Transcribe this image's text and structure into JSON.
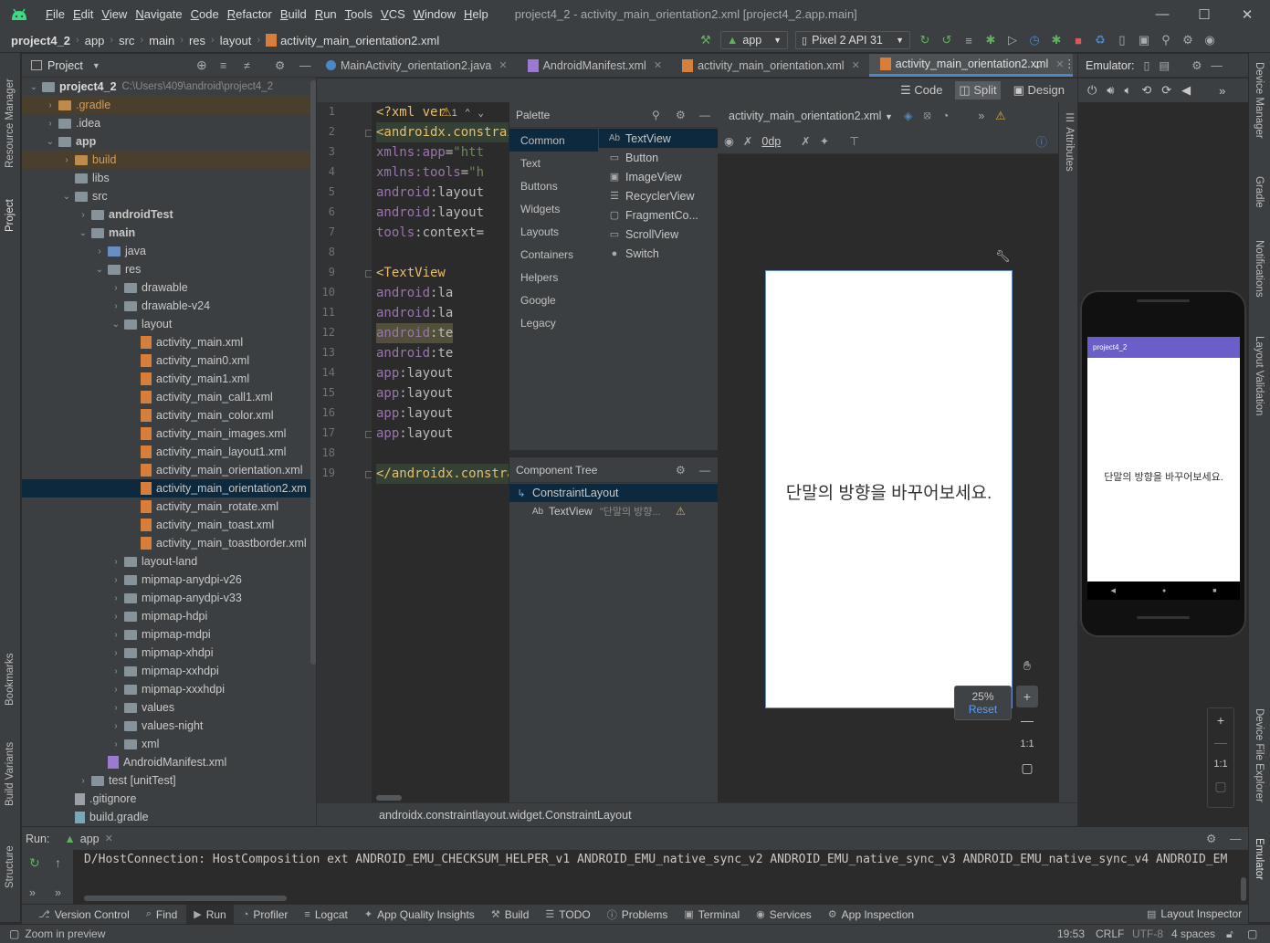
{
  "window": {
    "menu": [
      "File",
      "Edit",
      "View",
      "Navigate",
      "Code",
      "Refactor",
      "Build",
      "Run",
      "Tools",
      "VCS",
      "Window",
      "Help"
    ],
    "title": "project4_2 - activity_main_orientation2.xml [project4_2.app.main]"
  },
  "breadcrumb": [
    "project4_2",
    "app",
    "src",
    "main",
    "res",
    "layout",
    "activity_main_orientation2.xml"
  ],
  "toolbar": {
    "run_config": "app",
    "device": "Pixel 2 API 31"
  },
  "left_strip": {
    "resource_manager": "Resource Manager",
    "project": "Project",
    "bookmarks": "Bookmarks",
    "build_variants": "Build Variants",
    "structure": "Structure"
  },
  "right_strip": {
    "device_manager": "Device Manager",
    "gradle": "Gradle",
    "notifications": "Notifications",
    "layout_validation": "Layout Validation",
    "device_file_explorer": "Device File Explorer",
    "emulator": "Emulator"
  },
  "project_panel": {
    "title": "Project",
    "root": {
      "name": "project4_2",
      "path": "C:\\Users\\409\\android\\project4_2"
    },
    "items": [
      {
        "label": ".gradle",
        "depth": 1,
        "icon": "orange",
        "expanded": false
      },
      {
        "label": ".idea",
        "depth": 1,
        "icon": "gray",
        "expanded": false
      },
      {
        "label": "app",
        "depth": 1,
        "icon": "gray",
        "expanded": true,
        "bold": true
      },
      {
        "label": "build",
        "depth": 2,
        "icon": "orange",
        "expanded": false
      },
      {
        "label": "libs",
        "depth": 2,
        "icon": "gray",
        "leaf": true
      },
      {
        "label": "src",
        "depth": 2,
        "icon": "gray",
        "expanded": true
      },
      {
        "label": "androidTest",
        "depth": 3,
        "icon": "gray",
        "expanded": false,
        "bold": true
      },
      {
        "label": "main",
        "depth": 3,
        "icon": "gray",
        "expanded": true,
        "bold": true
      },
      {
        "label": "java",
        "depth": 4,
        "icon": "blue",
        "expanded": false
      },
      {
        "label": "res",
        "depth": 4,
        "icon": "gray",
        "expanded": true
      },
      {
        "label": "drawable",
        "depth": 5,
        "icon": "gray",
        "expanded": false
      },
      {
        "label": "drawable-v24",
        "depth": 5,
        "icon": "gray",
        "expanded": false
      },
      {
        "label": "layout",
        "depth": 5,
        "icon": "gray",
        "expanded": true
      },
      {
        "label": "activity_main.xml",
        "depth": 6,
        "icon": "xml",
        "leaf": true
      },
      {
        "label": "activity_main0.xml",
        "depth": 6,
        "icon": "xml",
        "leaf": true
      },
      {
        "label": "activity_main1.xml",
        "depth": 6,
        "icon": "xml",
        "leaf": true
      },
      {
        "label": "activity_main_call1.xml",
        "depth": 6,
        "icon": "xml",
        "leaf": true
      },
      {
        "label": "activity_main_color.xml",
        "depth": 6,
        "icon": "xml",
        "leaf": true
      },
      {
        "label": "activity_main_images.xml",
        "depth": 6,
        "icon": "xml",
        "leaf": true
      },
      {
        "label": "activity_main_layout1.xml",
        "depth": 6,
        "icon": "xml",
        "leaf": true
      },
      {
        "label": "activity_main_orientation.xml",
        "depth": 6,
        "icon": "xml",
        "leaf": true
      },
      {
        "label": "activity_main_orientation2.xm",
        "depth": 6,
        "icon": "xml",
        "leaf": true,
        "selected": true
      },
      {
        "label": "activity_main_rotate.xml",
        "depth": 6,
        "icon": "xml",
        "leaf": true
      },
      {
        "label": "activity_main_toast.xml",
        "depth": 6,
        "icon": "xml",
        "leaf": true
      },
      {
        "label": "activity_main_toastborder.xml",
        "depth": 6,
        "icon": "xml",
        "leaf": true
      },
      {
        "label": "layout-land",
        "depth": 5,
        "icon": "gray",
        "expanded": false
      },
      {
        "label": "mipmap-anydpi-v26",
        "depth": 5,
        "icon": "gray",
        "expanded": false
      },
      {
        "label": "mipmap-anydpi-v33",
        "depth": 5,
        "icon": "gray",
        "expanded": false
      },
      {
        "label": "mipmap-hdpi",
        "depth": 5,
        "icon": "gray",
        "expanded": false
      },
      {
        "label": "mipmap-mdpi",
        "depth": 5,
        "icon": "gray",
        "expanded": false
      },
      {
        "label": "mipmap-xhdpi",
        "depth": 5,
        "icon": "gray",
        "expanded": false
      },
      {
        "label": "mipmap-xxhdpi",
        "depth": 5,
        "icon": "gray",
        "expanded": false
      },
      {
        "label": "mipmap-xxxhdpi",
        "depth": 5,
        "icon": "gray",
        "expanded": false
      },
      {
        "label": "values",
        "depth": 5,
        "icon": "gray",
        "expanded": false
      },
      {
        "label": "values-night",
        "depth": 5,
        "icon": "gray",
        "expanded": false
      },
      {
        "label": "xml",
        "depth": 5,
        "icon": "gray",
        "expanded": false
      },
      {
        "label": "AndroidManifest.xml",
        "depth": 4,
        "icon": "manifest",
        "leaf": true
      },
      {
        "label": "test [unitTest]",
        "depth": 3,
        "icon": "gray",
        "expanded": false
      },
      {
        "label": ".gitignore",
        "depth": 2,
        "icon": "file",
        "leaf": true
      },
      {
        "label": "build.gradle",
        "depth": 2,
        "icon": "gradle",
        "leaf": true
      }
    ]
  },
  "editor_tabs": [
    {
      "label": "MainActivity_orientation2.java",
      "active": false
    },
    {
      "label": "AndroidManifest.xml",
      "active": false
    },
    {
      "label": "activity_main_orientation.xml",
      "active": false
    },
    {
      "label": "activity_main_orientation2.xml",
      "active": true
    }
  ],
  "view_modes": {
    "code": "Code",
    "split": "Split",
    "design": "Design"
  },
  "code": {
    "warning_count": "1",
    "lines": [
      [
        [
          "t-pi",
          "<?xml ver"
        ]
      ],
      [
        [
          "t-tag",
          "<androidx.constrai"
        ]
      ],
      [
        [
          "t-attr",
          "    "
        ],
        [
          "t-ns",
          "xmlns:app"
        ],
        [
          "t-attr",
          "="
        ],
        [
          "t-val",
          "\"htt"
        ]
      ],
      [
        [
          "t-attr",
          "    "
        ],
        [
          "t-ns",
          "xmlns:tools"
        ],
        [
          "t-attr",
          "="
        ],
        [
          "t-val",
          "\"h"
        ]
      ],
      [
        [
          "t-attr",
          "    "
        ],
        [
          "t-ns",
          "android"
        ],
        [
          "t-attr",
          ":layout"
        ]
      ],
      [
        [
          "t-attr",
          "    "
        ],
        [
          "t-ns",
          "android"
        ],
        [
          "t-attr",
          ":layout"
        ]
      ],
      [
        [
          "t-attr",
          "    "
        ],
        [
          "t-ns",
          "tools"
        ],
        [
          "t-attr",
          ":context="
        ]
      ],
      [
        [
          "t-attr",
          ""
        ]
      ],
      [
        [
          "t-attr",
          "    "
        ],
        [
          "t-tag",
          "<TextView"
        ]
      ],
      [
        [
          "t-attr",
          "        "
        ],
        [
          "t-ns",
          "android"
        ],
        [
          "t-attr",
          ":la"
        ]
      ],
      [
        [
          "t-attr",
          "        "
        ],
        [
          "t-ns",
          "android"
        ],
        [
          "t-attr",
          ":la"
        ]
      ],
      [
        [
          "t-attr",
          "        "
        ],
        [
          "t-ns",
          "android"
        ],
        [
          "t-attr",
          ":te"
        ]
      ],
      [
        [
          "t-attr",
          "        "
        ],
        [
          "t-ns",
          "android"
        ],
        [
          "t-attr",
          ":te"
        ]
      ],
      [
        [
          "t-attr",
          "        "
        ],
        [
          "t-ns",
          "app"
        ],
        [
          "t-attr",
          ":layout"
        ]
      ],
      [
        [
          "t-attr",
          "        "
        ],
        [
          "t-ns",
          "app"
        ],
        [
          "t-attr",
          ":layout"
        ]
      ],
      [
        [
          "t-attr",
          "        "
        ],
        [
          "t-ns",
          "app"
        ],
        [
          "t-attr",
          ":layout"
        ]
      ],
      [
        [
          "t-attr",
          "        "
        ],
        [
          "t-ns",
          "app"
        ],
        [
          "t-attr",
          ":layout"
        ]
      ],
      [
        [
          "t-attr",
          ""
        ]
      ],
      [
        [
          "t-tag",
          "</androidx.constra"
        ]
      ]
    ],
    "status": "androidx.constraintlayout.widget.ConstraintLayout"
  },
  "palette": {
    "title": "Palette",
    "categories": [
      "Common",
      "Text",
      "Buttons",
      "Widgets",
      "Layouts",
      "Containers",
      "Helpers",
      "Google",
      "Legacy"
    ],
    "items": [
      {
        "icon": "Ab",
        "label": "TextView"
      },
      {
        "icon": "btn",
        "label": "Button"
      },
      {
        "icon": "img",
        "label": "ImageView"
      },
      {
        "icon": "list",
        "label": "RecyclerView"
      },
      {
        "icon": "frag",
        "label": "FragmentCo..."
      },
      {
        "icon": "scroll",
        "label": "ScrollView"
      },
      {
        "icon": "sw",
        "label": "Switch"
      }
    ]
  },
  "component_tree": {
    "title": "Component Tree",
    "root": "ConstraintLayout",
    "child": {
      "icon": "Ab",
      "label": "TextView",
      "preview": "\"단말의 방향..."
    }
  },
  "design": {
    "file_selector": "activity_main_orientation2.xml",
    "margin": "0dp",
    "preview_text": "단말의 방향을 바꾸어보세요.",
    "zoom": "25%",
    "reset": "Reset",
    "one_to_one": "1:1"
  },
  "attributes_tab": "Attributes",
  "emulator": {
    "title": "Emulator:",
    "app_title": "project4_2",
    "screen_text": "단말의 방향을 바꾸어보세요.",
    "one_to_one": "1:1"
  },
  "run": {
    "label": "Run:",
    "tab": "app",
    "log": "D/HostConnection: HostComposition ext ANDROID_EMU_CHECKSUM_HELPER_v1 ANDROID_EMU_native_sync_v2 ANDROID_EMU_native_sync_v3 ANDROID_EMU_native_sync_v4 ANDROID_EM"
  },
  "tool_windows": [
    "Version Control",
    "Find",
    "Run",
    "Profiler",
    "Logcat",
    "App Quality Insights",
    "Build",
    "TODO",
    "Problems",
    "Terminal",
    "Services",
    "App Inspection"
  ],
  "layout_inspector": "Layout Inspector",
  "statusbar": {
    "message": "Zoom in preview",
    "position": "19:53",
    "line_sep": "CRLF",
    "encoding": "UTF-8",
    "indent": "4 spaces"
  },
  "colors": {
    "accent": "#4a88c7",
    "selection": "#0d293e",
    "app_bar": "#6a5fc8"
  }
}
